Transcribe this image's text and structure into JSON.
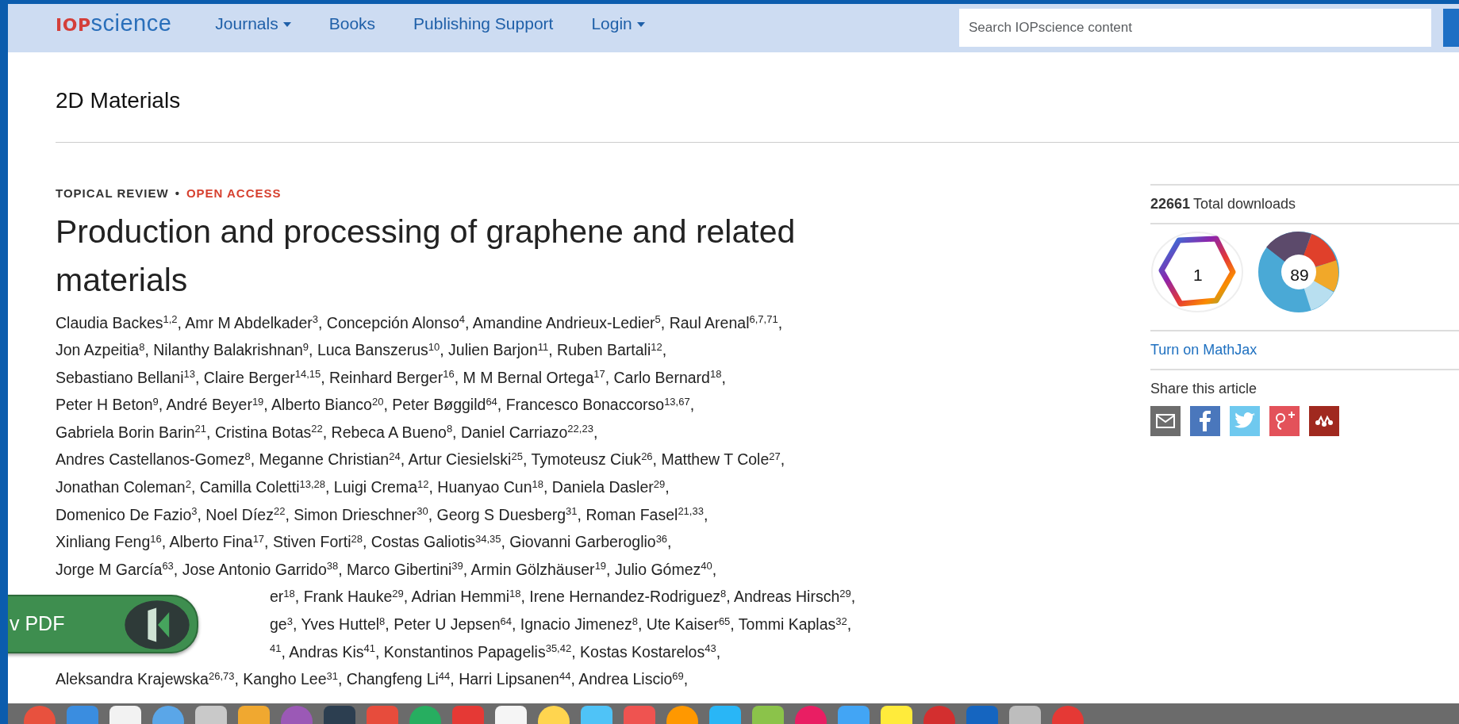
{
  "navbar": {
    "logo": {
      "prefix": "IOP",
      "suffix": "science"
    },
    "items": [
      {
        "label": "Journals",
        "dropdown": true
      },
      {
        "label": "Books",
        "dropdown": false
      },
      {
        "label": "Publishing Support",
        "dropdown": false
      },
      {
        "label": "Login",
        "dropdown": true
      }
    ],
    "search": {
      "placeholder": "Search IOPscience content"
    }
  },
  "journal": "2D Materials",
  "article": {
    "type": "TOPICAL REVIEW",
    "separator": "•",
    "access": "OPEN ACCESS",
    "title": "Production and processing of graphene and related materials",
    "author_lines": [
      {
        "text": "Claudia Backes$^{1,2}$, Amr M Abdelkader$^{3}$, Concepción Alonso$^{4}$, Amandine Andrieux-Ledier$^{5}$, Raul Arenal$^{6,7,71}$,",
        "kind": "full"
      },
      {
        "text": "Jon Azpeitia$^{8}$, Nilanthy Balakrishnan$^{9}$, Luca Banszerus$^{10}$, Julien Barjon$^{11}$, Ruben Bartali$^{12}$,",
        "kind": "full"
      },
      {
        "text": "Sebastiano Bellani$^{13}$, Claire Berger$^{14,15}$, Reinhard Berger$^{16}$, M M Bernal Ortega$^{17}$, Carlo Bernard$^{18}$,",
        "kind": "full"
      },
      {
        "text": "Peter H Beton$^{9}$, André Beyer$^{19}$, Alberto Bianco$^{20}$, Peter Bøggild$^{64}$, Francesco Bonaccorso$^{13,67}$,",
        "kind": "full"
      },
      {
        "text": "Gabriela Borin Barin$^{21}$, Cristina Botas$^{22}$, Rebeca A Bueno$^{8}$, Daniel Carriazo$^{22,23}$,",
        "kind": "full"
      },
      {
        "text": "Andres Castellanos-Gomez$^{8}$, Meganne Christian$^{24}$, Artur Ciesielski$^{25}$, Tymoteusz Ciuk$^{26}$, Matthew T Cole$^{27}$,",
        "kind": "full"
      },
      {
        "text": "Jonathan Coleman$^{2}$, Camilla Coletti$^{13,28}$, Luigi Crema$^{12}$, Huanyao Cun$^{18}$, Daniela Dasler$^{29}$,",
        "kind": "full"
      },
      {
        "text": "Domenico De Fazio$^{3}$, Noel Díez$^{22}$, Simon Drieschner$^{30}$, Georg S Duesberg$^{31}$, Roman Fasel$^{21,33}$,",
        "kind": "full"
      },
      {
        "text": "Xinliang Feng$^{16}$, Alberto Fina$^{17}$, Stiven Forti$^{28}$, Costas Galiotis$^{34,35}$, Giovanni Garberoglio$^{36}$,",
        "kind": "full"
      },
      {
        "text": "Jorge M García$^{63}$, Jose Antonio Garrido$^{38}$, Marco Gibertini$^{39}$, Armin Gölzhäuser$^{19}$, Julio Gómez$^{40}$,",
        "kind": "full"
      },
      {
        "text": "er$^{18}$, Frank Hauke$^{29}$, Adrian Hemmi$^{18}$, Irene Hernandez-Rodriguez$^{8}$, Andreas Hirsch$^{29}$,",
        "kind": "partial"
      },
      {
        "text": "ge$^{3}$, Yves Huttel$^{8}$, Peter U Jepsen$^{64}$, Ignacio Jimenez$^{8}$, Ute Kaiser$^{65}$, Tommi Kaplas$^{32}$,",
        "kind": "partial"
      },
      {
        "text": "$^{41}$, Andras Kis$^{41}$, Konstantinos Papagelis$^{35,42}$, Kostas Kostarelos$^{43}$,",
        "kind": "partial"
      },
      {
        "text": "Aleksandra Krajewska$^{26,73}$, Kangho Lee$^{31}$, Changfeng Li$^{44}$, Harri Lipsanen$^{44}$, Andrea Liscio$^{69}$,",
        "kind": "full"
      }
    ]
  },
  "sidebar": {
    "downloads_count": "22661",
    "downloads_label": "Total downloads",
    "badges": [
      {
        "kind": "dimensions",
        "count": "1"
      },
      {
        "kind": "altmetric",
        "count": "89"
      }
    ],
    "mathjax_link": "Turn on MathJax",
    "share_label": "Share this article",
    "share_buttons": [
      {
        "kind": "email"
      },
      {
        "kind": "facebook"
      },
      {
        "kind": "twitter"
      },
      {
        "kind": "googleplus"
      },
      {
        "kind": "mendeley"
      }
    ]
  },
  "pdf_button": {
    "label": "v PDF"
  }
}
